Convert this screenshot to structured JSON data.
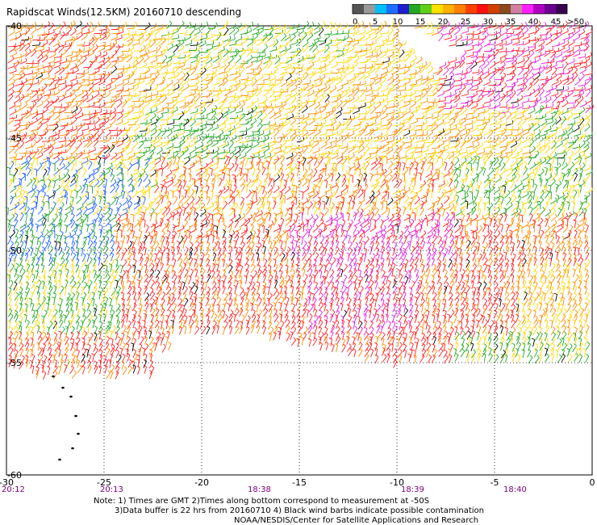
{
  "title": "Rapidscat Winds(12.5KM) 20160710 descending",
  "legend": {
    "colors": [
      "#555555",
      "#999999",
      "#00bfff",
      "#1e6fff",
      "#1f1fd0",
      "#22a822",
      "#5fd01a",
      "#ffe000",
      "#ffb000",
      "#ff8000",
      "#ff4000",
      "#ff1010",
      "#d04000",
      "#8a4a20",
      "#d080a0",
      "#ff20ff",
      "#b000c0",
      "#6a0090",
      "#3a0050"
    ],
    "labels": [
      "0",
      "5",
      "10",
      "15",
      "20",
      "25",
      "30",
      "35",
      "40",
      "45",
      ">50 knots"
    ],
    "label_positions": [
      0,
      2,
      4,
      6,
      8,
      10,
      12,
      14,
      16,
      18,
      19
    ]
  },
  "axes": {
    "x_ticks": [
      "-30",
      "-25",
      "-20",
      "-15",
      "-10",
      "-5",
      "0"
    ],
    "y_ticks": [
      "-40",
      "-45",
      "-50",
      "-55",
      "-60"
    ],
    "y_tick_labels": [
      "-40",
      "-45",
      "-50",
      "-55",
      "-60"
    ]
  },
  "times": [
    "20:12",
    "20:13",
    "18:38",
    "18:39",
    "18:40"
  ],
  "notes": {
    "line1": "Note: 1) Times are GMT 2)Times along bottom correspond to measurement at -50S",
    "line2": "3)Data buffer is 22 hrs from 20160710 4) Black wind barbs indicate possible contamination",
    "line3": "NOAA/NESDIS/Center for Satellite Applications and Research"
  },
  "map_colors": {
    "green": "#22a822",
    "yellow": "#ffd800",
    "orange": "#ff8c00",
    "red": "#ff2020",
    "magenta": "#e020e0",
    "blue": "#1e60ff",
    "black": "#000000"
  }
}
